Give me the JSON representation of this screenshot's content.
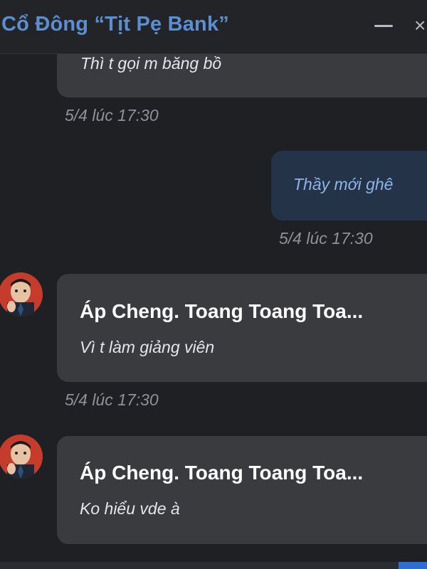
{
  "header": {
    "title": "Cổ Đông “Tịt Pẹ Bank”",
    "minimize_icon": "minimize-icon",
    "close_glyph": "×"
  },
  "messages": [
    {
      "sender": "",
      "text": "Thì t gọi m băng bồ",
      "timestamp": "5/4 lúc 17:30",
      "mine": false
    },
    {
      "sender": "",
      "text": "Thầy mới ghê",
      "timestamp": "5/4 lúc 17:30",
      "mine": true
    },
    {
      "sender": "Áp Cheng. Toang Toang Toa...",
      "text": "Vì t làm giảng viên",
      "timestamp": "5/4 lúc 17:30",
      "mine": false,
      "avatar": "user-avatar"
    },
    {
      "sender": "Áp Cheng. Toang Toang Toa...",
      "text": "Ko hiểu vde à",
      "timestamp": "",
      "mine": false,
      "avatar": "user-avatar"
    }
  ],
  "colors": {
    "background": "#1f2024",
    "bubble_other": "#3a3b3f",
    "bubble_mine": "#243347",
    "title": "#5b8fd1",
    "timestamp": "#8e9198"
  }
}
